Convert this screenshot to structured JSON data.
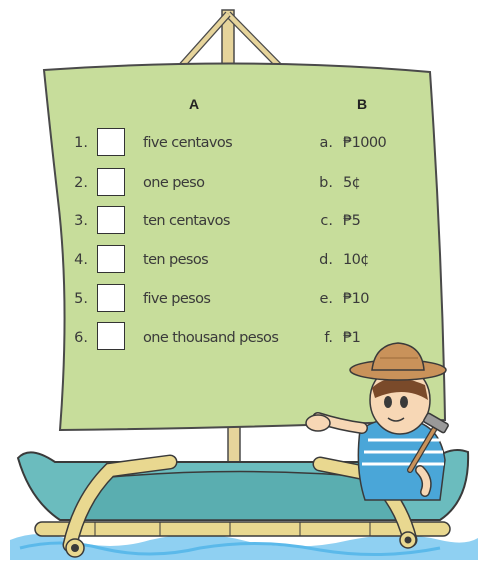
{
  "headers": {
    "a": "A",
    "b": "B"
  },
  "rows": [
    {
      "num": "1.",
      "a": "five centavos",
      "letter": "a.",
      "b": "₱1000"
    },
    {
      "num": "2.",
      "a": "one peso",
      "letter": "b.",
      "b": "5¢"
    },
    {
      "num": "3.",
      "a": "ten centavos",
      "letter": "c.",
      "b": "₱5"
    },
    {
      "num": "4.",
      "a": "ten pesos",
      "letter": "d.",
      "b": "10¢"
    },
    {
      "num": "5.",
      "a": "five pesos",
      "letter": "e.",
      "b": "₱10"
    },
    {
      "num": "6.",
      "a": "one thousand pesos",
      "letter": "f.",
      "b": "₱1"
    }
  ],
  "colors": {
    "sail": "#c7dd9b",
    "sail_outline": "#4a4a4a",
    "mast": "#e6d49b",
    "bamboo": "#e9d890",
    "boat": "#6bbcbe",
    "water": "#5bb9ea",
    "shirt": "#4aa6d8",
    "hat": "#c9925a"
  },
  "icons": [
    "sail",
    "mast",
    "bamboo-raft",
    "boy-with-hat",
    "hammer-icon",
    "water-waves"
  ]
}
